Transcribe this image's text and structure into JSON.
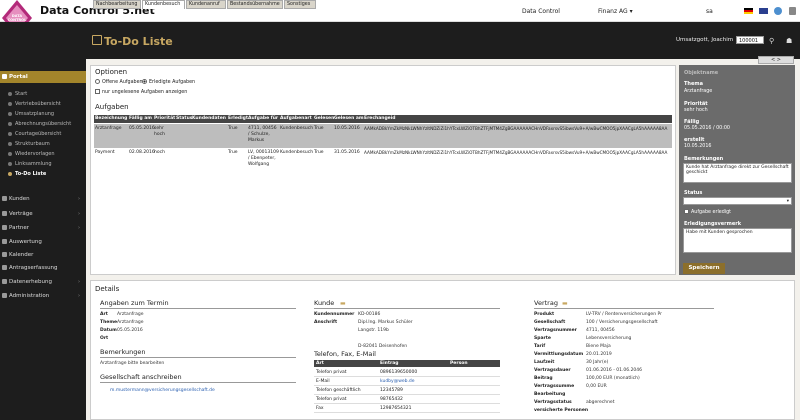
{
  "app": {
    "title": "Data Control 5.net",
    "logo_text": "DATA CONTROL"
  },
  "topnav": {
    "data_control": "Data Control",
    "finanz": "Finanz AG",
    "user": "sa"
  },
  "colors": {
    "accent": "#a3852b",
    "title_gold": "#c8a862",
    "dark": "#1d1d1d",
    "panel_gray": "#6b6b6b"
  },
  "header": {
    "page_title": "To-Do Liste",
    "user_as": "Umsatzgott, Joachim",
    "user_no": "100001"
  },
  "sidebar": {
    "portal": "Portal",
    "sub": [
      "Start",
      "Vertriebsübersicht",
      "Umsatzplanung",
      "Abrechnungsübersicht",
      "Courtageübersicht",
      "Strukturbaum",
      "Wiedervorlagen",
      "Linksammlung",
      "To-Do Liste"
    ],
    "items": [
      "Kunden",
      "Verträge",
      "Partner",
      "Auswertung",
      "Kalender",
      "Antragserfassung",
      "Datenerhebung",
      "Administration"
    ]
  },
  "tabs": [
    "Nachbearbeitung",
    "Kundenbesuch",
    "Kundenanruf",
    "Bestandsübernahme",
    "Sonstiges"
  ],
  "nav_arrows": "<  >",
  "options": {
    "title": "Optionen",
    "offene": "Offene Aufgaben",
    "erledigte": "Erledigte Aufgaben",
    "ungelesene": "nur ungelesene Aufgaben anzeigen"
  },
  "tasks": {
    "title": "Aufgaben",
    "columns": [
      "Bezeichnung",
      "Fällig am",
      "Priorität",
      "Status",
      "Kundendaten",
      "Erledigt",
      "Aufgabe für",
      "Aufgabenart",
      "Gelesen",
      "Gelesen am",
      "Erechangeid"
    ],
    "rows": [
      {
        "bez": "Arztanfrage",
        "faellig": "05.05.2016",
        "prio1": "sehr",
        "prio2": "hoch",
        "erledigt": "True",
        "kd1": "4711, 00456",
        "kd2": "/ Schulze,",
        "kd3": "Markus",
        "art": "Kundenbesuch",
        "gel": "True",
        "gelam": "10.05.2016",
        "exid": "AAMkADBkYmZkMzNkLWNhYzItNDZiZi1hYTcxLWZiOTBhZTFjMTM4ZgBGAAAAAACHnVDFaxrsvS5ibwsVu9+A/wBwCMOO5jpXAACgLA5hAAAAA8AA"
      },
      {
        "bez": "Payment",
        "faellig": "02.08.2016",
        "prio1": "hoch",
        "prio2": "",
        "erledigt": "True",
        "kd1": "LV, 00013109",
        "kd2": "/ Ebenpeter,",
        "kd3": "Wolfgang",
        "art": "Kundenbesuch",
        "gel": "True",
        "gelam": "31.05.2016",
        "exid": "AAMkADBkYmZkMzNkLWNhYzItNDZiZi1hYTcxLWZiOTBhZTFjMTM4ZgBGAAAAAACHnVDFaxrsvS5ibwsVu9+A/wBwCMOO5jpXAACgLA5hAAAAA8AA"
      }
    ]
  },
  "right_panel": {
    "header": "Objektname",
    "thema_label": "Thema",
    "thema": "Arztanfrage",
    "prio_label": "Priorität",
    "prio": "sehr hoch",
    "faellig_label": "Fällig",
    "faellig": "05.05.2016 / 00:00",
    "erstellt_label": "erstellt",
    "erstellt": "10.05.2016",
    "bem_label": "Bemerkungen",
    "bem": "Kunde hat Arztanfrage direkt zur Gesellschaft geschickt",
    "status_label": "Status",
    "erledigt": "Aufgabe erledigt",
    "erg_label": "Erledigungsvermerk",
    "erg": "Habe mit Kunden gesprochen",
    "save": "Speichern"
  },
  "details": {
    "title": "Details",
    "termin": {
      "title": "Angaben zum Termin",
      "art_l": "Art",
      "art": "Arztanfrage",
      "thema_l": "Theme",
      "thema": "Arztanfrage",
      "datum_l": "Datum",
      "datum": "05.05.2016",
      "ort_l": "Ort"
    },
    "bem": {
      "title": "Bemerkungen",
      "text": "Arztanfrage bitte bearbeiten"
    },
    "ges": {
      "title": "Gesellschaft anschreiben",
      "email": "m.mustermann@versicherungsgesellschaft.de"
    },
    "kunde": {
      "title": "Kunde",
      "knr_l": "Kundennummer",
      "knr": "KD-00186",
      "ans_l": "Anschrift",
      "a1": "Dipl.Ing. Markus Schüler",
      "a2": "Langstr. 119b",
      "a3": "",
      "a4": "D-82041 Deisenhofen"
    },
    "tel": {
      "title": "Telefon, Fax, E-Mail",
      "cols": [
        "Art",
        "Eintrag",
        "Person"
      ],
      "rows": [
        [
          "Telefon privat",
          "0896139650000",
          ""
        ],
        [
          "E-Mail",
          "kudby@web.de",
          ""
        ],
        [
          "Telefon geschäftlich",
          "12345789",
          ""
        ],
        [
          "Telefon privat",
          "98765432",
          ""
        ],
        [
          "Fax",
          "12987654321",
          ""
        ]
      ]
    },
    "vertrag": {
      "title": "Vertrag",
      "rows": [
        [
          "Produkt",
          "LV-TRV / Rentenversicherungen Pr"
        ],
        [
          "Gesellschaft",
          "100 / Versicherungsgesellschaft"
        ],
        [
          "Vertragsnummer",
          "4711, 00456"
        ],
        [
          "Sparte",
          "Lebensversicherung"
        ],
        [
          "Tarif",
          "Biene Maja"
        ],
        [
          "Vermittlungsdatum",
          "20.01.2019"
        ],
        [
          "Laufzeit",
          "30 Jahr(e)"
        ],
        [
          "Vertragsdauer",
          "01.06.2016 - 01.06.2046"
        ],
        [
          "Beitrag",
          "100,00 EUR (monatlich)"
        ],
        [
          "Vertragssumme",
          "0,00 EUR"
        ],
        [
          "Bearbeitung",
          ""
        ],
        [
          "Vertragsstatus",
          "abgerechnet"
        ],
        [
          "versicherte Personen",
          ""
        ]
      ]
    }
  }
}
